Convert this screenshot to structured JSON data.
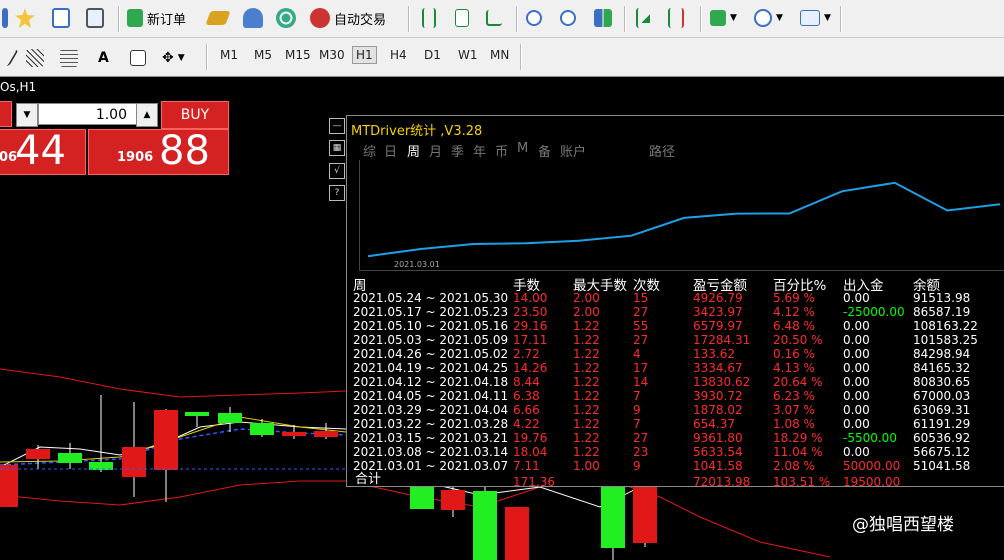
{
  "toolbar1": {
    "new_order": "新订单",
    "auto_trading": "自动交易"
  },
  "toolbar2": {
    "text_tool": "A",
    "timeframes": [
      "M1",
      "M5",
      "M15",
      "M30",
      "H1",
      "H4",
      "D1",
      "W1",
      "MN"
    ],
    "selected": "H1"
  },
  "chart": {
    "title": "Os,H1"
  },
  "one_click": {
    "volume": "1.00",
    "buy_label": "BUY",
    "sell_price_small": "06",
    "sell_price_big": "44",
    "buy_price_small": "1906",
    "buy_price_big": "88"
  },
  "stats": {
    "title": "MTDriver统计 ,V3.28",
    "tabs": [
      "综",
      "日",
      "周",
      "月",
      "季",
      "年",
      "币",
      "M",
      "备",
      "账户"
    ],
    "active_tab": "周",
    "path_label": "路径",
    "equity_axis_label": "2021.03.01",
    "equity_curve": [
      51041.58,
      56675.12,
      60536.92,
      61191.29,
      63069.31,
      67000.03,
      80830.65,
      84165.32,
      84298.94,
      101583.25,
      108163.22,
      86587.19,
      91513.98
    ],
    "headers": [
      "周",
      "手数",
      "最大手数",
      "次数",
      "盈亏金额",
      "百分比%",
      "出入金",
      "余额"
    ],
    "rows": [
      {
        "week": "2021.05.24 ~ 2021.05.30",
        "lots": "14.00",
        "max_lots": "2.00",
        "count": "15",
        "pnl": "4926.79",
        "pct": "5.69 %",
        "flow": "0.00",
        "balance": "91513.98"
      },
      {
        "week": "2021.05.17 ~ 2021.05.23",
        "lots": "23.50",
        "max_lots": "2.00",
        "count": "27",
        "pnl": "3423.97",
        "pct": "4.12 %",
        "flow": "-25000.00",
        "balance": "86587.19"
      },
      {
        "week": "2021.05.10 ~ 2021.05.16",
        "lots": "29.16",
        "max_lots": "1.22",
        "count": "55",
        "pnl": "6579.97",
        "pct": "6.48 %",
        "flow": "0.00",
        "balance": "108163.22"
      },
      {
        "week": "2021.05.03 ~ 2021.05.09",
        "lots": "17.11",
        "max_lots": "1.22",
        "count": "27",
        "pnl": "17284.31",
        "pct": "20.50 %",
        "flow": "0.00",
        "balance": "101583.25"
      },
      {
        "week": "2021.04.26 ~ 2021.05.02",
        "lots": "2.72",
        "max_lots": "1.22",
        "count": "4",
        "pnl": "133.62",
        "pct": "0.16 %",
        "flow": "0.00",
        "balance": "84298.94"
      },
      {
        "week": "2021.04.19 ~ 2021.04.25",
        "lots": "14.26",
        "max_lots": "1.22",
        "count": "17",
        "pnl": "3334.67",
        "pct": "4.13 %",
        "flow": "0.00",
        "balance": "84165.32"
      },
      {
        "week": "2021.04.12 ~ 2021.04.18",
        "lots": "8.44",
        "max_lots": "1.22",
        "count": "14",
        "pnl": "13830.62",
        "pct": "20.64 %",
        "flow": "0.00",
        "balance": "80830.65"
      },
      {
        "week": "2021.04.05 ~ 2021.04.11",
        "lots": "6.38",
        "max_lots": "1.22",
        "count": "7",
        "pnl": "3930.72",
        "pct": "6.23 %",
        "flow": "0.00",
        "balance": "67000.03"
      },
      {
        "week": "2021.03.29 ~ 2021.04.04",
        "lots": "6.66",
        "max_lots": "1.22",
        "count": "9",
        "pnl": "1878.02",
        "pct": "3.07 %",
        "flow": "0.00",
        "balance": "63069.31"
      },
      {
        "week": "2021.03.22 ~ 2021.03.28",
        "lots": "4.22",
        "max_lots": "1.22",
        "count": "7",
        "pnl": "654.37",
        "pct": "1.08 %",
        "flow": "0.00",
        "balance": "61191.29"
      },
      {
        "week": "2021.03.15 ~ 2021.03.21",
        "lots": "19.76",
        "max_lots": "1.22",
        "count": "27",
        "pnl": "9361.80",
        "pct": "18.29 %",
        "flow": "-5500.00",
        "balance": "60536.92"
      },
      {
        "week": "2021.03.08 ~ 2021.03.14",
        "lots": "18.04",
        "max_lots": "1.22",
        "count": "23",
        "pnl": "5633.54",
        "pct": "11.04 %",
        "flow": "0.00",
        "balance": "56675.12"
      },
      {
        "week": "2021.03.01 ~ 2021.03.07",
        "lots": "7.11",
        "max_lots": "1.00",
        "count": "9",
        "pnl": "1041.58",
        "pct": "2.08 %",
        "flow": "50000.00",
        "balance": "51041.58"
      }
    ],
    "total": {
      "label": "合计",
      "lots": "171.36",
      "pnl": "72013.98",
      "pct": "103.51 %",
      "flow": "19500.00"
    }
  },
  "watermark": "@独唱西望楼",
  "colors": {
    "red": "#ff2a2a",
    "green": "#00ff00",
    "white": "#ffffff",
    "accent": "#1ea0e6"
  }
}
